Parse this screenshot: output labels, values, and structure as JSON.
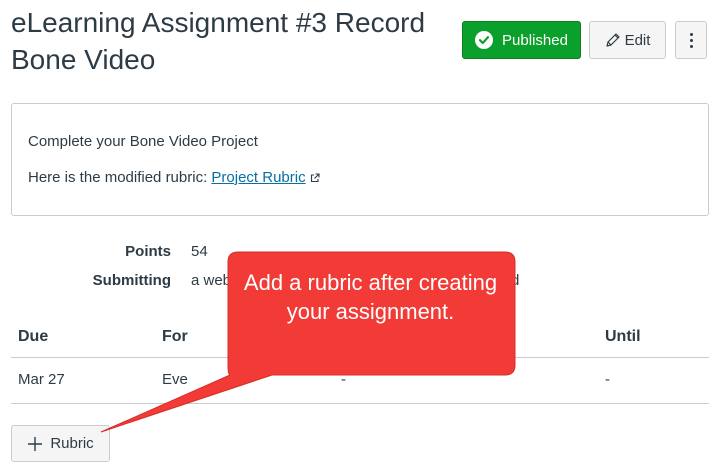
{
  "assignment": {
    "title": "eLearning Assignment #3 Record Bone Video"
  },
  "header_buttons": {
    "published_label": "Published",
    "edit_label": "Edit"
  },
  "description": {
    "line1": "Complete your Bone Video Project",
    "line2_prefix": "Here is the modified rubric: ",
    "link_text": "Project Rubric"
  },
  "details": {
    "points_label": "Points",
    "points_value": "54",
    "submitting_label": "Submitting",
    "submitting_value_visible_start": "a web",
    "submitting_value_visible_end": "d"
  },
  "dates_table": {
    "headers": [
      "Due",
      "For",
      "Until"
    ],
    "row": {
      "due": "Mar 27",
      "for": "Eve",
      "available_from": "-",
      "until": "-"
    }
  },
  "rubric_button": {
    "label": "Rubric"
  },
  "callout": {
    "text": "Add a rubric after creating your assignment."
  },
  "colors": {
    "published_green": "#0b9f2b",
    "link_blue": "#0770a3",
    "callout_red": "#f23b37",
    "text": "#2d3b45",
    "border": "#c7cdd1"
  }
}
